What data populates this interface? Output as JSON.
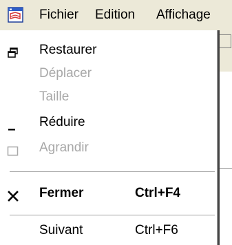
{
  "menubar": {
    "items": [
      {
        "label": "Fichier"
      },
      {
        "label": "Edition"
      },
      {
        "label": "Affichage"
      }
    ]
  },
  "system_menu": {
    "items": [
      {
        "label": "Restaurer",
        "shortcut": "",
        "enabled": true,
        "icon": "restore-icon"
      },
      {
        "label": "Déplacer",
        "shortcut": "",
        "enabled": false,
        "icon": ""
      },
      {
        "label": "Taille",
        "shortcut": "",
        "enabled": false,
        "icon": ""
      },
      {
        "label": "Réduire",
        "shortcut": "",
        "enabled": true,
        "icon": "minimize-icon"
      },
      {
        "label": "Agrandir",
        "shortcut": "",
        "enabled": false,
        "icon": "maximize-icon"
      },
      {
        "label": "Fermer",
        "shortcut": "Ctrl+F4",
        "enabled": true,
        "bold": true,
        "icon": "close-icon"
      },
      {
        "label": "Suivant",
        "shortcut": "Ctrl+F6",
        "enabled": true,
        "icon": ""
      }
    ]
  },
  "colors": {
    "menubar_bg": "#ece9d8",
    "menu_bg": "#ffffff",
    "disabled_text": "#a8a8a8",
    "separator": "#a0a0a0"
  }
}
